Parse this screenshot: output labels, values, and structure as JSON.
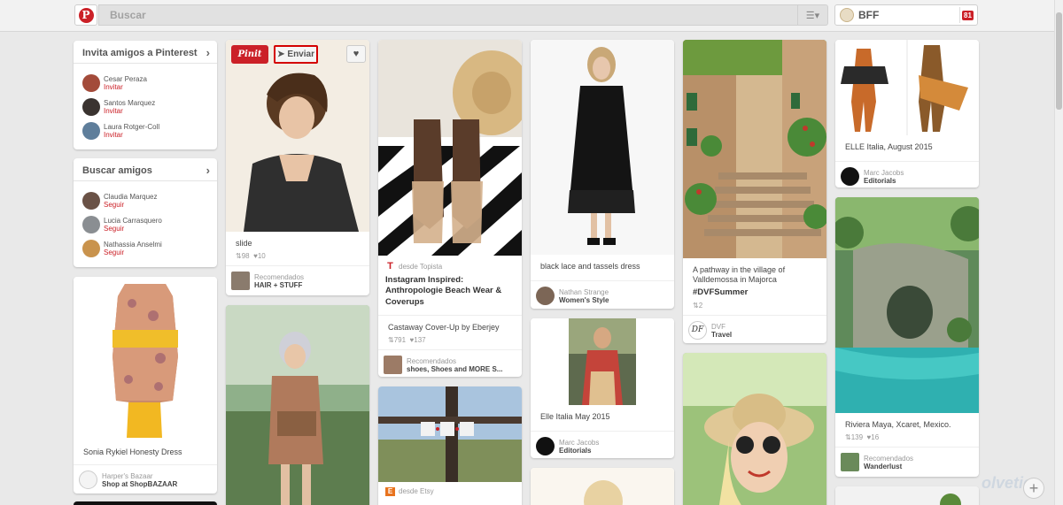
{
  "header": {
    "search_placeholder": "Buscar",
    "user_name": "BFF",
    "notifications": "81"
  },
  "invite": {
    "title": "Invita amigos a Pinterest",
    "people": [
      {
        "name": "Cesar Peraza",
        "action": "Invitar"
      },
      {
        "name": "Santos Marquez",
        "action": "Invitar"
      },
      {
        "name": "Laura Rotger-Coll",
        "action": "Invitar"
      }
    ]
  },
  "find": {
    "title": "Buscar amigos",
    "people": [
      {
        "name": "Claudia Marquez",
        "action": "Seguir"
      },
      {
        "name": "Lucia Carrasquero",
        "action": "Seguir"
      },
      {
        "name": "Nathassia Anselmi",
        "action": "Seguir"
      }
    ]
  },
  "pins": {
    "dress": {
      "desc": "Sonia Rykiel Honesty Dress",
      "a1": "Harper's Bazaar",
      "a2": "Shop at ShopBAZAAR"
    },
    "slide": {
      "pinit": "Pinit",
      "enviar": "Enviar",
      "heart": "♥",
      "desc": "slide",
      "repins": "98",
      "likes": "10",
      "a1": "Recomendados",
      "a2": "HAIR + STUFF"
    },
    "shoes": {
      "via": "desde Topista",
      "title": "Instagram Inspired: Anthropologie Beach Wear & Coverups",
      "desc": "Castaway Cover-Up by Eberjey",
      "repins": "791",
      "likes": "137",
      "a1": "Recomendados",
      "a2": "shoes, Shoes and MORE S..."
    },
    "etsy": {
      "via": "desde Etsy"
    },
    "lace": {
      "desc": "black lace and tassels dress",
      "a1": "Nathan Strange",
      "a2": "Women's Style"
    },
    "elle2": {
      "desc": "Elle Italia May 2015",
      "a1": "Marc Jacobs",
      "a2": "Editorials"
    },
    "majorca": {
      "desc": "A pathway in the village of Valldemossa in Majorca",
      "tag": "#DVFSummer",
      "repins": "2",
      "a1": "DVF",
      "a2": "Travel"
    },
    "elle1": {
      "desc": "ELLE Italia, August 2015",
      "a1": "Marc Jacobs",
      "a2": "Editorials"
    },
    "xcaret": {
      "desc": "Riviera Maya, Xcaret, Mexico.",
      "repins": "139",
      "likes": "16",
      "a1": "Recomendados",
      "a2": "Wanderlust"
    }
  },
  "watermark": "olvetic",
  "colors": {
    "brand": "#cb2027",
    "background": "#e9e9e9"
  }
}
